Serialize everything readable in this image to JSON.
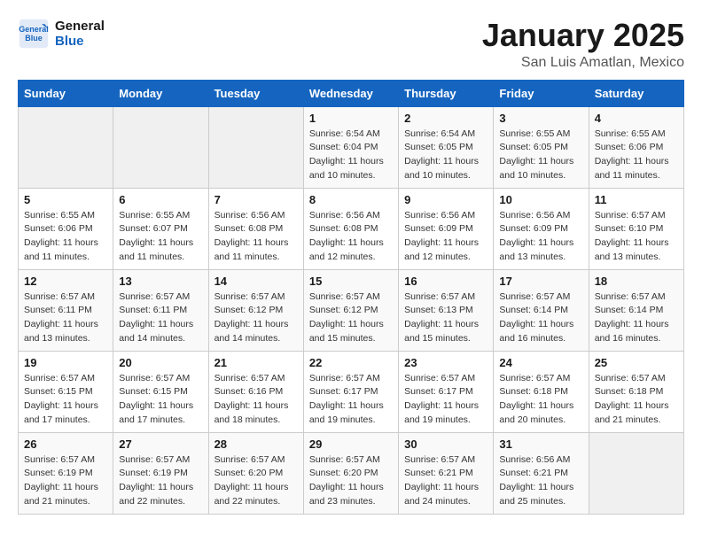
{
  "header": {
    "logo_line1": "General",
    "logo_line2": "Blue",
    "month": "January 2025",
    "location": "San Luis Amatlan, Mexico"
  },
  "days_of_week": [
    "Sunday",
    "Monday",
    "Tuesday",
    "Wednesday",
    "Thursday",
    "Friday",
    "Saturday"
  ],
  "weeks": [
    [
      {
        "day": "",
        "info": ""
      },
      {
        "day": "",
        "info": ""
      },
      {
        "day": "",
        "info": ""
      },
      {
        "day": "1",
        "info": "Sunrise: 6:54 AM\nSunset: 6:04 PM\nDaylight: 11 hours and 10 minutes."
      },
      {
        "day": "2",
        "info": "Sunrise: 6:54 AM\nSunset: 6:05 PM\nDaylight: 11 hours and 10 minutes."
      },
      {
        "day": "3",
        "info": "Sunrise: 6:55 AM\nSunset: 6:05 PM\nDaylight: 11 hours and 10 minutes."
      },
      {
        "day": "4",
        "info": "Sunrise: 6:55 AM\nSunset: 6:06 PM\nDaylight: 11 hours and 11 minutes."
      }
    ],
    [
      {
        "day": "5",
        "info": "Sunrise: 6:55 AM\nSunset: 6:06 PM\nDaylight: 11 hours and 11 minutes."
      },
      {
        "day": "6",
        "info": "Sunrise: 6:55 AM\nSunset: 6:07 PM\nDaylight: 11 hours and 11 minutes."
      },
      {
        "day": "7",
        "info": "Sunrise: 6:56 AM\nSunset: 6:08 PM\nDaylight: 11 hours and 11 minutes."
      },
      {
        "day": "8",
        "info": "Sunrise: 6:56 AM\nSunset: 6:08 PM\nDaylight: 11 hours and 12 minutes."
      },
      {
        "day": "9",
        "info": "Sunrise: 6:56 AM\nSunset: 6:09 PM\nDaylight: 11 hours and 12 minutes."
      },
      {
        "day": "10",
        "info": "Sunrise: 6:56 AM\nSunset: 6:09 PM\nDaylight: 11 hours and 13 minutes."
      },
      {
        "day": "11",
        "info": "Sunrise: 6:57 AM\nSunset: 6:10 PM\nDaylight: 11 hours and 13 minutes."
      }
    ],
    [
      {
        "day": "12",
        "info": "Sunrise: 6:57 AM\nSunset: 6:11 PM\nDaylight: 11 hours and 13 minutes."
      },
      {
        "day": "13",
        "info": "Sunrise: 6:57 AM\nSunset: 6:11 PM\nDaylight: 11 hours and 14 minutes."
      },
      {
        "day": "14",
        "info": "Sunrise: 6:57 AM\nSunset: 6:12 PM\nDaylight: 11 hours and 14 minutes."
      },
      {
        "day": "15",
        "info": "Sunrise: 6:57 AM\nSunset: 6:12 PM\nDaylight: 11 hours and 15 minutes."
      },
      {
        "day": "16",
        "info": "Sunrise: 6:57 AM\nSunset: 6:13 PM\nDaylight: 11 hours and 15 minutes."
      },
      {
        "day": "17",
        "info": "Sunrise: 6:57 AM\nSunset: 6:14 PM\nDaylight: 11 hours and 16 minutes."
      },
      {
        "day": "18",
        "info": "Sunrise: 6:57 AM\nSunset: 6:14 PM\nDaylight: 11 hours and 16 minutes."
      }
    ],
    [
      {
        "day": "19",
        "info": "Sunrise: 6:57 AM\nSunset: 6:15 PM\nDaylight: 11 hours and 17 minutes."
      },
      {
        "day": "20",
        "info": "Sunrise: 6:57 AM\nSunset: 6:15 PM\nDaylight: 11 hours and 17 minutes."
      },
      {
        "day": "21",
        "info": "Sunrise: 6:57 AM\nSunset: 6:16 PM\nDaylight: 11 hours and 18 minutes."
      },
      {
        "day": "22",
        "info": "Sunrise: 6:57 AM\nSunset: 6:17 PM\nDaylight: 11 hours and 19 minutes."
      },
      {
        "day": "23",
        "info": "Sunrise: 6:57 AM\nSunset: 6:17 PM\nDaylight: 11 hours and 19 minutes."
      },
      {
        "day": "24",
        "info": "Sunrise: 6:57 AM\nSunset: 6:18 PM\nDaylight: 11 hours and 20 minutes."
      },
      {
        "day": "25",
        "info": "Sunrise: 6:57 AM\nSunset: 6:18 PM\nDaylight: 11 hours and 21 minutes."
      }
    ],
    [
      {
        "day": "26",
        "info": "Sunrise: 6:57 AM\nSunset: 6:19 PM\nDaylight: 11 hours and 21 minutes."
      },
      {
        "day": "27",
        "info": "Sunrise: 6:57 AM\nSunset: 6:19 PM\nDaylight: 11 hours and 22 minutes."
      },
      {
        "day": "28",
        "info": "Sunrise: 6:57 AM\nSunset: 6:20 PM\nDaylight: 11 hours and 22 minutes."
      },
      {
        "day": "29",
        "info": "Sunrise: 6:57 AM\nSunset: 6:20 PM\nDaylight: 11 hours and 23 minutes."
      },
      {
        "day": "30",
        "info": "Sunrise: 6:57 AM\nSunset: 6:21 PM\nDaylight: 11 hours and 24 minutes."
      },
      {
        "day": "31",
        "info": "Sunrise: 6:56 AM\nSunset: 6:21 PM\nDaylight: 11 hours and 25 minutes."
      },
      {
        "day": "",
        "info": ""
      }
    ]
  ]
}
